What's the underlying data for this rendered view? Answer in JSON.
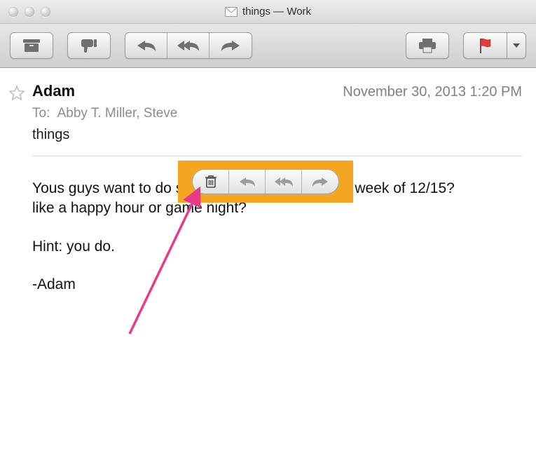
{
  "window": {
    "title": "things — Work"
  },
  "toolbar": {
    "archive": "Archive",
    "junk": "Junk",
    "reply": "Reply",
    "reply_all": "Reply All",
    "forward": "Forward",
    "print": "Print",
    "flag": "Flag"
  },
  "message": {
    "sender": "Adam",
    "date": "November 30, 2013  1:20 PM",
    "to_label": "To:",
    "recipients": "Abby T. Miller,    Steve",
    "subject": "things",
    "body": {
      "p1": "Yous guys want to do something a weeknight the week of 12/15? like a happy hour or game night?",
      "p2": "Hint: you do.",
      "p3": "-Adam"
    }
  },
  "hover_toolbar": {
    "trash": "Delete",
    "reply": "Reply",
    "reply_all": "Reply All",
    "forward": "Forward"
  }
}
